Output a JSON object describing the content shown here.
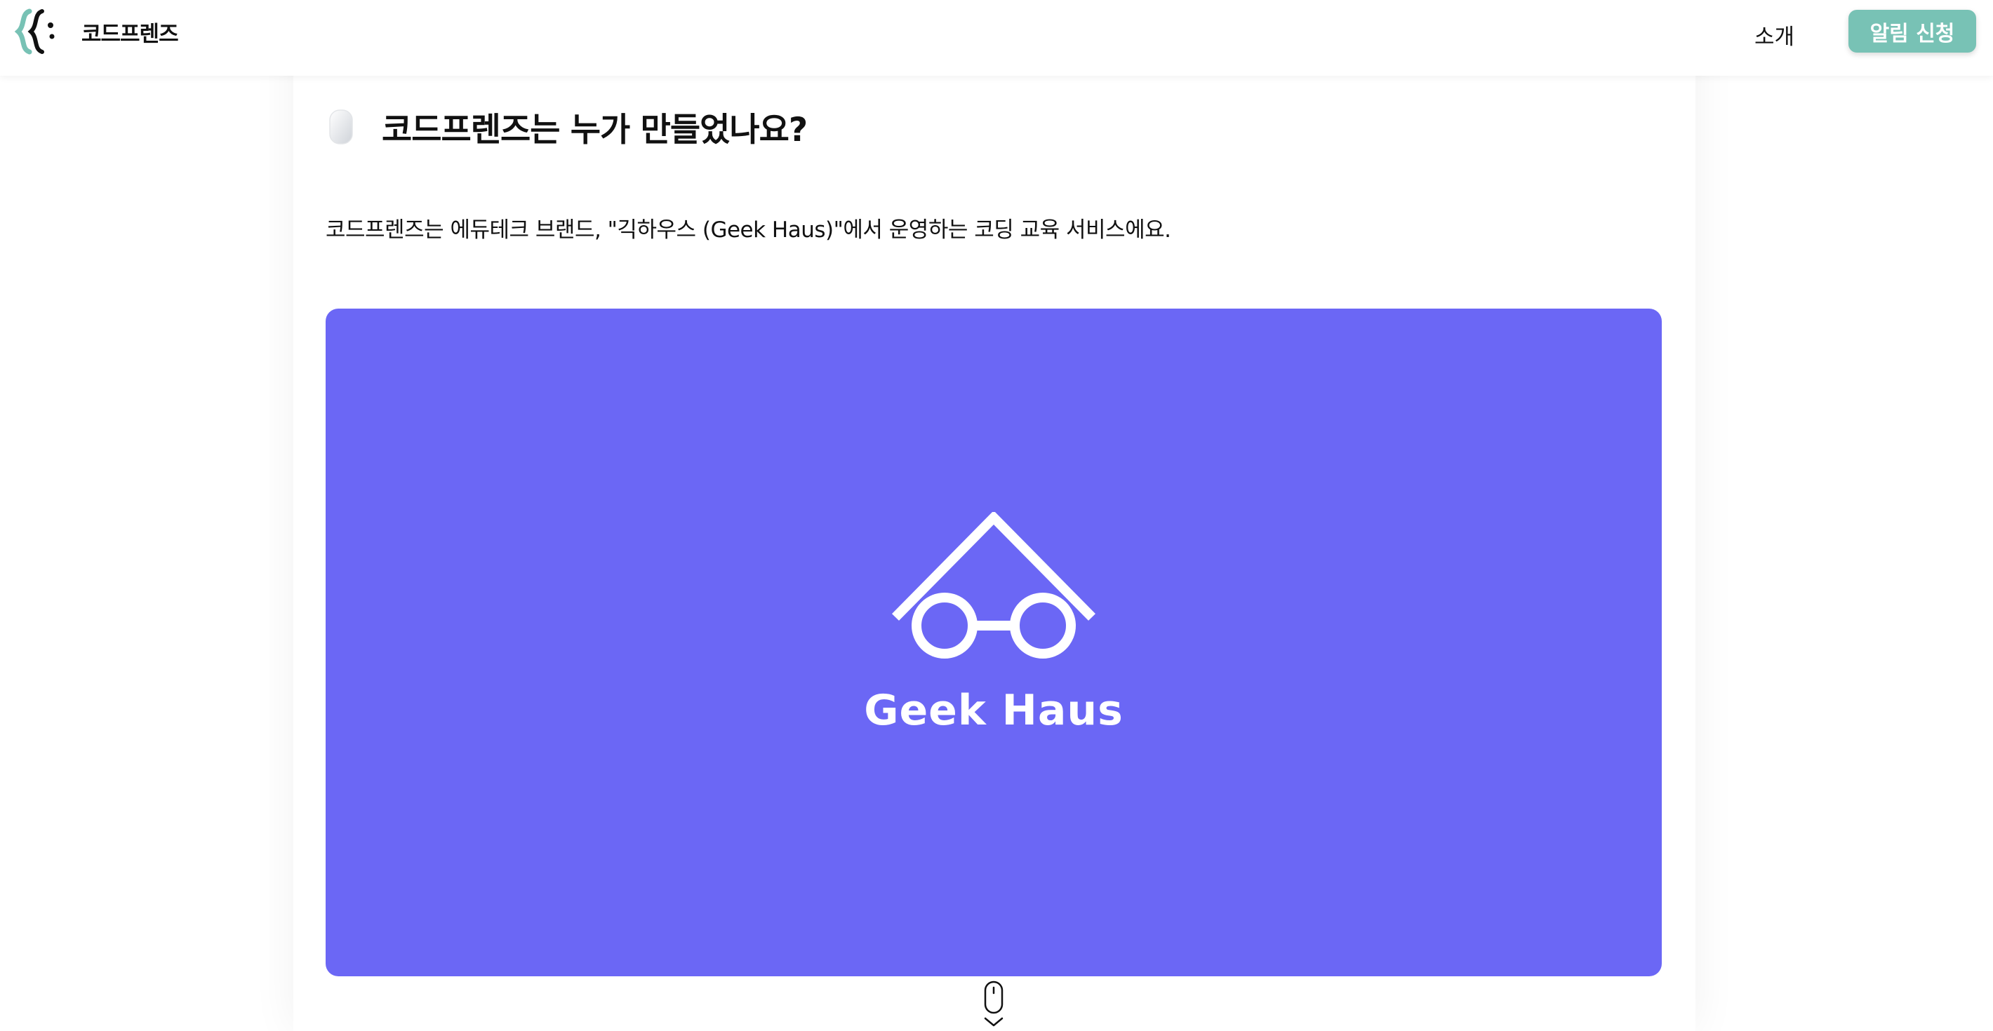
{
  "navbar": {
    "brand_name": "코드프렌즈",
    "logo_icon": "codefriends-logo-icon",
    "nav_link": "소개",
    "cta_label": "알림 신청",
    "accent_color": "#78c2b5"
  },
  "section": {
    "icon": "computer-mouse-icon",
    "heading": "코드프렌즈는 누가 만들었나요?",
    "body": "코드프렌즈는 에듀테크 브랜드, \"긱하우스 (Geek Haus)\"에서 운영하는 코딩 교육 서비스에요."
  },
  "banner": {
    "background_color": "#6b67f5",
    "logo_icon": "glasses-logo-icon",
    "wordmark": "Geek Haus"
  },
  "scroll_indicator": {
    "icon": "scroll-down-mouse-icon"
  }
}
